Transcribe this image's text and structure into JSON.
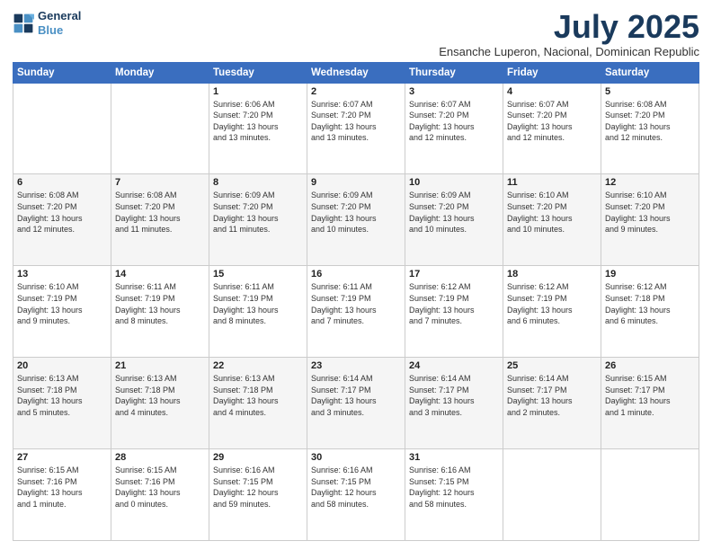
{
  "logo": {
    "line1": "General",
    "line2": "Blue"
  },
  "title": "July 2025",
  "subtitle": "Ensanche Luperon, Nacional, Dominican Republic",
  "weekdays": [
    "Sunday",
    "Monday",
    "Tuesday",
    "Wednesday",
    "Thursday",
    "Friday",
    "Saturday"
  ],
  "weeks": [
    [
      {
        "day": "",
        "info": ""
      },
      {
        "day": "",
        "info": ""
      },
      {
        "day": "1",
        "info": "Sunrise: 6:06 AM\nSunset: 7:20 PM\nDaylight: 13 hours\nand 13 minutes."
      },
      {
        "day": "2",
        "info": "Sunrise: 6:07 AM\nSunset: 7:20 PM\nDaylight: 13 hours\nand 13 minutes."
      },
      {
        "day": "3",
        "info": "Sunrise: 6:07 AM\nSunset: 7:20 PM\nDaylight: 13 hours\nand 12 minutes."
      },
      {
        "day": "4",
        "info": "Sunrise: 6:07 AM\nSunset: 7:20 PM\nDaylight: 13 hours\nand 12 minutes."
      },
      {
        "day": "5",
        "info": "Sunrise: 6:08 AM\nSunset: 7:20 PM\nDaylight: 13 hours\nand 12 minutes."
      }
    ],
    [
      {
        "day": "6",
        "info": "Sunrise: 6:08 AM\nSunset: 7:20 PM\nDaylight: 13 hours\nand 12 minutes."
      },
      {
        "day": "7",
        "info": "Sunrise: 6:08 AM\nSunset: 7:20 PM\nDaylight: 13 hours\nand 11 minutes."
      },
      {
        "day": "8",
        "info": "Sunrise: 6:09 AM\nSunset: 7:20 PM\nDaylight: 13 hours\nand 11 minutes."
      },
      {
        "day": "9",
        "info": "Sunrise: 6:09 AM\nSunset: 7:20 PM\nDaylight: 13 hours\nand 10 minutes."
      },
      {
        "day": "10",
        "info": "Sunrise: 6:09 AM\nSunset: 7:20 PM\nDaylight: 13 hours\nand 10 minutes."
      },
      {
        "day": "11",
        "info": "Sunrise: 6:10 AM\nSunset: 7:20 PM\nDaylight: 13 hours\nand 10 minutes."
      },
      {
        "day": "12",
        "info": "Sunrise: 6:10 AM\nSunset: 7:20 PM\nDaylight: 13 hours\nand 9 minutes."
      }
    ],
    [
      {
        "day": "13",
        "info": "Sunrise: 6:10 AM\nSunset: 7:19 PM\nDaylight: 13 hours\nand 9 minutes."
      },
      {
        "day": "14",
        "info": "Sunrise: 6:11 AM\nSunset: 7:19 PM\nDaylight: 13 hours\nand 8 minutes."
      },
      {
        "day": "15",
        "info": "Sunrise: 6:11 AM\nSunset: 7:19 PM\nDaylight: 13 hours\nand 8 minutes."
      },
      {
        "day": "16",
        "info": "Sunrise: 6:11 AM\nSunset: 7:19 PM\nDaylight: 13 hours\nand 7 minutes."
      },
      {
        "day": "17",
        "info": "Sunrise: 6:12 AM\nSunset: 7:19 PM\nDaylight: 13 hours\nand 7 minutes."
      },
      {
        "day": "18",
        "info": "Sunrise: 6:12 AM\nSunset: 7:19 PM\nDaylight: 13 hours\nand 6 minutes."
      },
      {
        "day": "19",
        "info": "Sunrise: 6:12 AM\nSunset: 7:18 PM\nDaylight: 13 hours\nand 6 minutes."
      }
    ],
    [
      {
        "day": "20",
        "info": "Sunrise: 6:13 AM\nSunset: 7:18 PM\nDaylight: 13 hours\nand 5 minutes."
      },
      {
        "day": "21",
        "info": "Sunrise: 6:13 AM\nSunset: 7:18 PM\nDaylight: 13 hours\nand 4 minutes."
      },
      {
        "day": "22",
        "info": "Sunrise: 6:13 AM\nSunset: 7:18 PM\nDaylight: 13 hours\nand 4 minutes."
      },
      {
        "day": "23",
        "info": "Sunrise: 6:14 AM\nSunset: 7:17 PM\nDaylight: 13 hours\nand 3 minutes."
      },
      {
        "day": "24",
        "info": "Sunrise: 6:14 AM\nSunset: 7:17 PM\nDaylight: 13 hours\nand 3 minutes."
      },
      {
        "day": "25",
        "info": "Sunrise: 6:14 AM\nSunset: 7:17 PM\nDaylight: 13 hours\nand 2 minutes."
      },
      {
        "day": "26",
        "info": "Sunrise: 6:15 AM\nSunset: 7:17 PM\nDaylight: 13 hours\nand 1 minute."
      }
    ],
    [
      {
        "day": "27",
        "info": "Sunrise: 6:15 AM\nSunset: 7:16 PM\nDaylight: 13 hours\nand 1 minute."
      },
      {
        "day": "28",
        "info": "Sunrise: 6:15 AM\nSunset: 7:16 PM\nDaylight: 13 hours\nand 0 minutes."
      },
      {
        "day": "29",
        "info": "Sunrise: 6:16 AM\nSunset: 7:15 PM\nDaylight: 12 hours\nand 59 minutes."
      },
      {
        "day": "30",
        "info": "Sunrise: 6:16 AM\nSunset: 7:15 PM\nDaylight: 12 hours\nand 58 minutes."
      },
      {
        "day": "31",
        "info": "Sunrise: 6:16 AM\nSunset: 7:15 PM\nDaylight: 12 hours\nand 58 minutes."
      },
      {
        "day": "",
        "info": ""
      },
      {
        "day": "",
        "info": ""
      }
    ]
  ]
}
